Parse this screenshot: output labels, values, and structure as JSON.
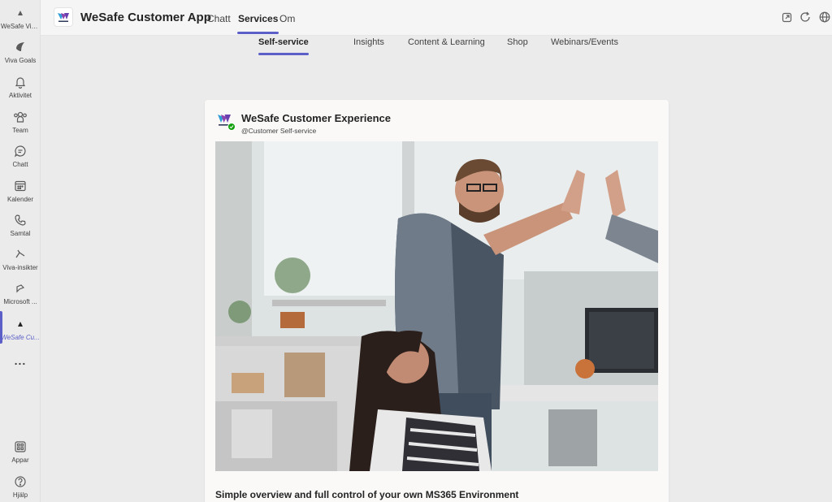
{
  "rail": {
    "items": [
      {
        "label": "WeSafe Viva...",
        "icon": "wesafe-icon"
      },
      {
        "label": "Viva Goals",
        "icon": "viva-goals-icon"
      },
      {
        "label": "Aktivitet",
        "icon": "bell-icon"
      },
      {
        "label": "Team",
        "icon": "team-icon"
      },
      {
        "label": "Chatt",
        "icon": "chat-icon"
      },
      {
        "label": "Kalender",
        "icon": "calendar-icon"
      },
      {
        "label": "Samtal",
        "icon": "phone-icon"
      },
      {
        "label": "Viva-insikter",
        "icon": "viva-insights-icon"
      },
      {
        "label": "Microsoft ...",
        "icon": "microsoft-icon"
      },
      {
        "label": "WeSafe Cu...",
        "icon": "wesafe-icon"
      }
    ],
    "more": "...",
    "apps_label": "Appar",
    "help_label": "Hjälp"
  },
  "header": {
    "app_title": "WeSafe Customer App",
    "tabs": [
      "Chatt",
      "Services",
      "Om"
    ],
    "active_tab": "Services"
  },
  "subtabs": {
    "items": [
      "Self-service",
      "Insights",
      "Content & Learning",
      "Shop",
      "Webinars/Events"
    ],
    "active": "Self-service"
  },
  "card": {
    "title": "WeSafe Customer Experience",
    "subtitle": "@Customer Self-service",
    "caption": "Simple overview and full control of your own MS365 Environment"
  },
  "colors": {
    "accent": "#5b5fc7",
    "verified": "#13a10e",
    "background": "#ebebeb"
  }
}
